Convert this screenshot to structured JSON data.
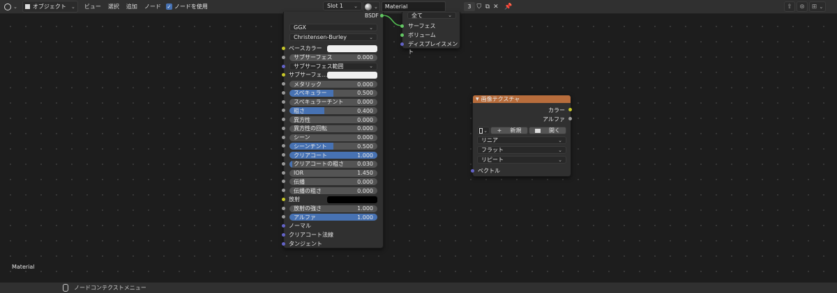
{
  "header": {
    "editor_type_icon": "node-editor-icon",
    "object_mode": "オブジェクト",
    "menus": [
      "ビュー",
      "選択",
      "追加",
      "ノード"
    ],
    "use_nodes_label": "ノードを使用",
    "use_nodes_checked": true,
    "slot": "Slot 1",
    "material_name": "Material",
    "material_users": "3"
  },
  "output_node": {
    "target": "全て",
    "inputs": [
      "サーフェス",
      "ボリューム",
      "ディスプレイスメント"
    ]
  },
  "bsdf_node": {
    "output_label": "BSDF",
    "distribution": "GGX",
    "subsurface_method": "Christensen-Burley",
    "rows": [
      {
        "label": "ベースカラー",
        "kind": "color",
        "color": "#f0f0f0",
        "socket": "yellow"
      },
      {
        "label": "サブサーフェス",
        "kind": "value",
        "value": "0.000",
        "socket": "gray"
      },
      {
        "label": "サブサーフェス範囲",
        "kind": "dropdown",
        "socket": "purple"
      },
      {
        "label": "サブサーフェ...",
        "kind": "color",
        "color": "#f0f0f0",
        "socket": "yellow"
      },
      {
        "label": "メタリック",
        "kind": "value",
        "value": "0.000",
        "fill": 0,
        "socket": "gray"
      },
      {
        "label": "スペキュラー",
        "kind": "value",
        "value": "0.500",
        "fill": 0.5,
        "socket": "gray"
      },
      {
        "label": "スペキュラーチント",
        "kind": "value",
        "value": "0.000",
        "fill": 0,
        "socket": "gray"
      },
      {
        "label": "粗さ",
        "kind": "value",
        "value": "0.400",
        "fill": 0.4,
        "socket": "gray"
      },
      {
        "label": "異方性",
        "kind": "value",
        "value": "0.000",
        "fill": 0,
        "socket": "gray"
      },
      {
        "label": "異方性の回転",
        "kind": "value",
        "value": "0.000",
        "fill": 0,
        "socket": "gray"
      },
      {
        "label": "シーン",
        "kind": "value",
        "value": "0.000",
        "fill": 0,
        "socket": "gray"
      },
      {
        "label": "シーンチント",
        "kind": "value",
        "value": "0.500",
        "fill": 0.5,
        "socket": "gray"
      },
      {
        "label": "クリアコート",
        "kind": "value",
        "value": "1.000",
        "fill": 1.0,
        "socket": "gray"
      },
      {
        "label": "クリアコートの粗さ",
        "kind": "value",
        "value": "0.030",
        "fill": 0.03,
        "socket": "gray"
      },
      {
        "label": "IOR",
        "kind": "value",
        "value": "1.450",
        "fill": 0,
        "socket": "gray"
      },
      {
        "label": "伝播",
        "kind": "value",
        "value": "0.000",
        "fill": 0,
        "socket": "gray"
      },
      {
        "label": "伝播の粗さ",
        "kind": "value",
        "value": "0.000",
        "fill": 0,
        "socket": "gray"
      },
      {
        "label": "放射",
        "kind": "color",
        "color": "#000000",
        "socket": "yellow"
      },
      {
        "label": "放射の強さ",
        "kind": "value",
        "value": "1.000",
        "fill": 0,
        "socket": "gray"
      },
      {
        "label": "アルファ",
        "kind": "value",
        "value": "1.000",
        "fill": 1.0,
        "socket": "gray"
      },
      {
        "label": "ノーマル",
        "kind": "socket",
        "socket": "purple"
      },
      {
        "label": "クリアコート法線",
        "kind": "socket",
        "socket": "purple"
      },
      {
        "label": "タンジェント",
        "kind": "socket",
        "socket": "purple"
      }
    ]
  },
  "image_node": {
    "title": "画像テクスチャ",
    "header_color": "#b86d3c",
    "outputs": [
      "カラー",
      "アルファ"
    ],
    "new_label": "新規",
    "open_label": "開く",
    "interpolation": "リニア",
    "projection": "フラット",
    "extension": "リピート",
    "input": "ベクトル"
  },
  "canvas_label": "Material",
  "footer": {
    "hint": "ノードコンテクストメニュー"
  }
}
